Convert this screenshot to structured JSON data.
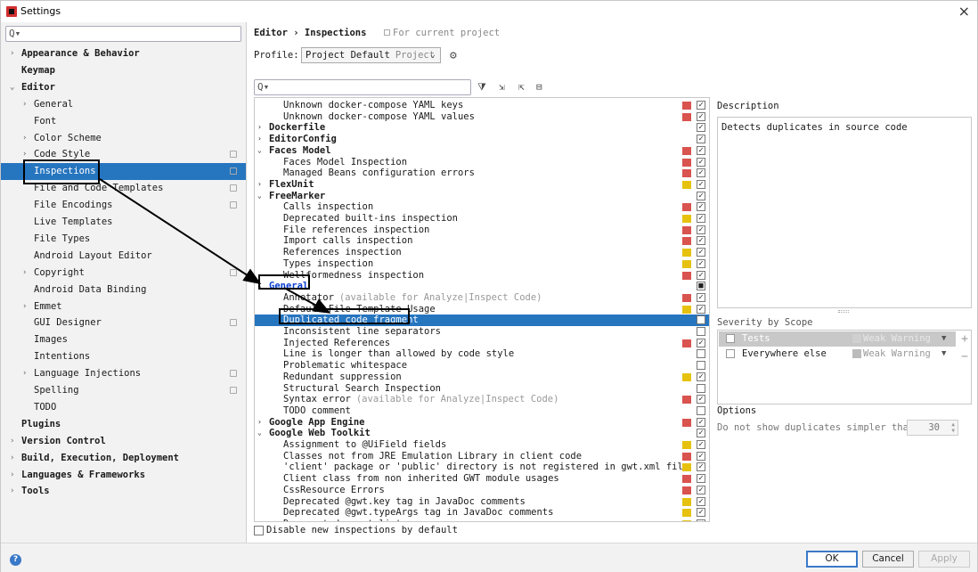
{
  "window": {
    "title": "Settings",
    "close": "×"
  },
  "sidebar": {
    "search_glyph": "Q▾",
    "items": [
      {
        "label": "Appearance & Behavior",
        "bold": true,
        "arrow": "›",
        "indent": 0
      },
      {
        "label": "Keymap",
        "bold": true,
        "arrow": "",
        "indent": 0
      },
      {
        "label": "Editor",
        "bold": true,
        "arrow": "⌄",
        "indent": 0
      },
      {
        "label": "General",
        "bold": false,
        "arrow": "›",
        "indent": 1
      },
      {
        "label": "Font",
        "bold": false,
        "arrow": "",
        "indent": 1
      },
      {
        "label": "Color Scheme",
        "bold": false,
        "arrow": "›",
        "indent": 1
      },
      {
        "label": "Code Style",
        "bold": false,
        "arrow": "›",
        "indent": 1,
        "copy": true
      },
      {
        "label": "Inspections",
        "bold": false,
        "arrow": "",
        "indent": 1,
        "copy": true,
        "selected": true
      },
      {
        "label": "File and Code Templates",
        "bold": false,
        "arrow": "",
        "indent": 1,
        "copy": true
      },
      {
        "label": "File Encodings",
        "bold": false,
        "arrow": "",
        "indent": 1,
        "copy": true
      },
      {
        "label": "Live Templates",
        "bold": false,
        "arrow": "",
        "indent": 1
      },
      {
        "label": "File Types",
        "bold": false,
        "arrow": "",
        "indent": 1
      },
      {
        "label": "Android Layout Editor",
        "bold": false,
        "arrow": "",
        "indent": 1
      },
      {
        "label": "Copyright",
        "bold": false,
        "arrow": "›",
        "indent": 1,
        "copy": true
      },
      {
        "label": "Android Data Binding",
        "bold": false,
        "arrow": "",
        "indent": 1
      },
      {
        "label": "Emmet",
        "bold": false,
        "arrow": "›",
        "indent": 1
      },
      {
        "label": "GUI Designer",
        "bold": false,
        "arrow": "",
        "indent": 1,
        "copy": true
      },
      {
        "label": "Images",
        "bold": false,
        "arrow": "",
        "indent": 1
      },
      {
        "label": "Intentions",
        "bold": false,
        "arrow": "",
        "indent": 1
      },
      {
        "label": "Language Injections",
        "bold": false,
        "arrow": "›",
        "indent": 1,
        "copy": true
      },
      {
        "label": "Spelling",
        "bold": false,
        "arrow": "",
        "indent": 1,
        "copy": true
      },
      {
        "label": "TODO",
        "bold": false,
        "arrow": "",
        "indent": 1
      },
      {
        "label": "Plugins",
        "bold": true,
        "arrow": "",
        "indent": 0
      },
      {
        "label": "Version Control",
        "bold": true,
        "arrow": "›",
        "indent": 0
      },
      {
        "label": "Build, Execution, Deployment",
        "bold": true,
        "arrow": "›",
        "indent": 0
      },
      {
        "label": "Languages & Frameworks",
        "bold": true,
        "arrow": "›",
        "indent": 0
      },
      {
        "label": "Tools",
        "bold": true,
        "arrow": "›",
        "indent": 0
      }
    ]
  },
  "header": {
    "breadcrumb": "Editor › Inspections",
    "scope_note": "For current project",
    "profile_label": "Profile:",
    "profile_value": "Project Default",
    "profile_sub": "Project",
    "profile_caret": "⌄"
  },
  "toolbar": {
    "search_glyph": "Q▾",
    "filter": "⧩",
    "expand": "⇲",
    "collapse": "⇱",
    "reset": "⊟",
    "gear": "⚙"
  },
  "colors": {
    "error": "#d9534f",
    "warning": "#e6c20f",
    "accent": "#2675bf"
  },
  "inspections": [
    {
      "label": "Unknown docker-compose YAML keys",
      "level": 1,
      "sev": "error",
      "check": "✓"
    },
    {
      "label": "Unknown docker-compose YAML values",
      "level": 1,
      "sev": "error",
      "check": "✓"
    },
    {
      "label": "Dockerfile",
      "level": 0,
      "arrow": "›",
      "check": "✓"
    },
    {
      "label": "EditorConfig",
      "level": 0,
      "arrow": "›",
      "check": "✓"
    },
    {
      "label": "Faces Model",
      "level": 0,
      "arrow": "⌄",
      "sev": "error",
      "check": "✓"
    },
    {
      "label": "Faces Model Inspection",
      "level": 1,
      "sev": "error",
      "check": "✓"
    },
    {
      "label": "Managed Beans configuration errors",
      "level": 1,
      "sev": "error",
      "check": "✓"
    },
    {
      "label": "FlexUnit",
      "level": 0,
      "arrow": "›",
      "sev": "warning",
      "check": "✓"
    },
    {
      "label": "FreeMarker",
      "level": 0,
      "arrow": "⌄",
      "check": "✓"
    },
    {
      "label": "Calls inspection",
      "level": 1,
      "sev": "error",
      "check": "✓"
    },
    {
      "label": "Deprecated built-ins inspection",
      "level": 1,
      "sev": "warning",
      "check": "✓"
    },
    {
      "label": "File references inspection",
      "level": 1,
      "sev": "error",
      "check": "✓"
    },
    {
      "label": "Import calls inspection",
      "level": 1,
      "sev": "error",
      "check": "✓"
    },
    {
      "label": "References inspection",
      "level": 1,
      "sev": "warning",
      "check": "✓"
    },
    {
      "label": "Types inspection",
      "level": 1,
      "sev": "warning",
      "check": "✓"
    },
    {
      "label": "Wellformedness inspection",
      "level": 1,
      "sev": "error",
      "check": "✓"
    },
    {
      "label": "General",
      "level": 0,
      "arrow": "⌄",
      "check": "■",
      "link": true
    },
    {
      "label": "Annotator",
      "note": "(available for Analyze|Inspect Code)",
      "level": 1,
      "sev": "error",
      "check": "✓"
    },
    {
      "label": "Default File Template Usage",
      "level": 1,
      "sev": "warning",
      "check": "✓"
    },
    {
      "label": "Duplicated code fragment",
      "level": 1,
      "check": "",
      "selected": true
    },
    {
      "label": "Inconsistent line separators",
      "level": 1,
      "check": ""
    },
    {
      "label": "Injected References",
      "level": 1,
      "sev": "error",
      "check": "✓"
    },
    {
      "label": "Line is longer than allowed by code style",
      "level": 1,
      "check": ""
    },
    {
      "label": "Problematic whitespace",
      "level": 1,
      "check": ""
    },
    {
      "label": "Redundant suppression",
      "level": 1,
      "sev": "warning",
      "check": "✓"
    },
    {
      "label": "Structural Search Inspection",
      "level": 1,
      "check": ""
    },
    {
      "label": "Syntax error",
      "note": "(available for Analyze|Inspect Code)",
      "level": 1,
      "sev": "error",
      "check": "✓"
    },
    {
      "label": "TODO comment",
      "level": 1,
      "check": ""
    },
    {
      "label": "Google App Engine",
      "level": 0,
      "arrow": "›",
      "sev": "error",
      "check": "✓"
    },
    {
      "label": "Google Web Toolkit",
      "level": 0,
      "arrow": "⌄",
      "check": "✓"
    },
    {
      "label": "Assignment to @UiField fields",
      "level": 1,
      "sev": "warning",
      "check": "✓"
    },
    {
      "label": "Classes not from JRE Emulation Library in client code",
      "level": 1,
      "sev": "error",
      "check": "✓"
    },
    {
      "label": "'client' package or 'public' directory is not registered in gwt.xml file",
      "level": 1,
      "sev": "warning",
      "check": "✓"
    },
    {
      "label": "Client class from non inherited GWT module usages",
      "level": 1,
      "sev": "error",
      "check": "✓"
    },
    {
      "label": "CssResource Errors",
      "level": 1,
      "sev": "error",
      "check": "✓"
    },
    {
      "label": "Deprecated @gwt.key tag in JavaDoc comments",
      "level": 1,
      "sev": "warning",
      "check": "✓"
    },
    {
      "label": "Deprecated @gwt.typeArgs tag in JavaDoc comments",
      "level": 1,
      "sev": "warning",
      "check": "✓"
    },
    {
      "label": "Deprecated event listeners",
      "level": 1,
      "sev": "warning",
      "check": "✓"
    }
  ],
  "description": {
    "label": "Description",
    "text": "Detects duplicates in source code"
  },
  "severity_scope": {
    "label": "Severity by Scope",
    "rows": [
      {
        "name": "Tests",
        "level": "Weak Warning",
        "dd": "▼"
      },
      {
        "name": "Everywhere else",
        "level": "Weak Warning",
        "dd": "▼"
      }
    ],
    "add": "+",
    "remove": "−"
  },
  "options": {
    "label": "Options",
    "text": "Do not show duplicates simpler than:",
    "value": "30"
  },
  "disable_new": "Disable new inspections by default",
  "buttons": {
    "help": "?",
    "ok": "OK",
    "cancel": "Cancel",
    "apply": "Apply"
  }
}
